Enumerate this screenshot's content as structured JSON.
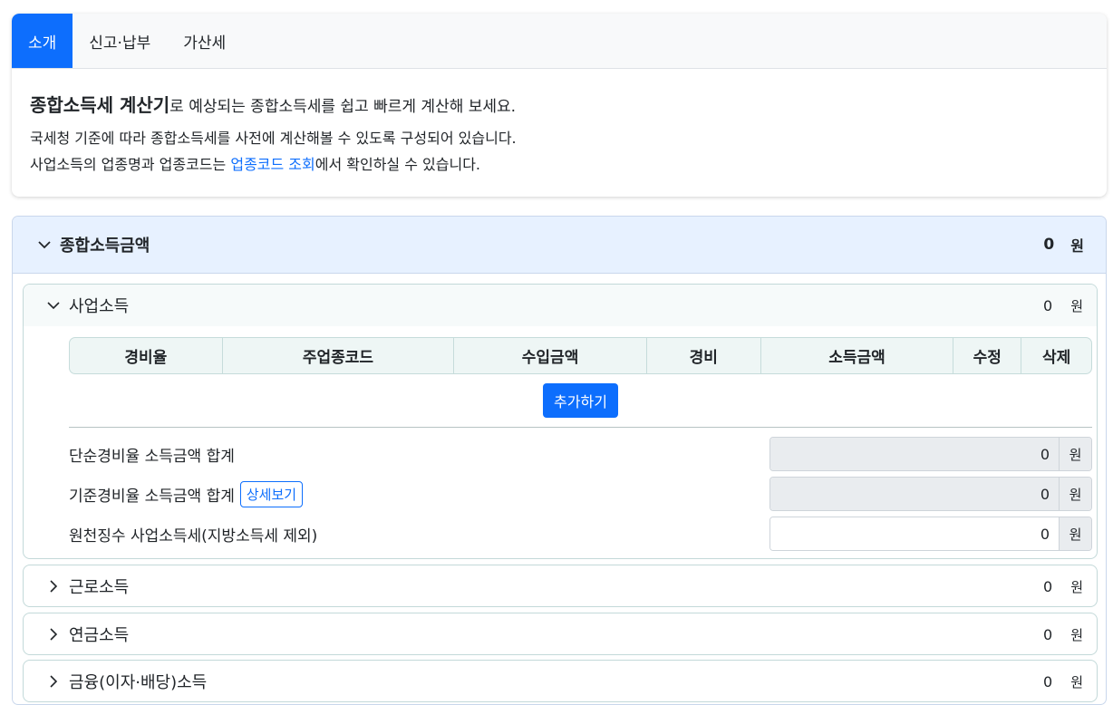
{
  "tabs": [
    {
      "label": "소개",
      "active": true
    },
    {
      "label": "신고·납부",
      "active": false
    },
    {
      "label": "가산세",
      "active": false
    }
  ],
  "intro": {
    "title_strong": "종합소득세 계산기",
    "title_rest": "로 예상되는 종합소득세를 쉽고 빠르게 계산해 보세요.",
    "line2": "국세청 기준에 따라 종합소득세를 사전에 계산해볼 수 있도록 구성되어 있습니다.",
    "line3_pre": "사업소득의 업종명과 업종코드는 ",
    "line3_link": "업종코드 조회",
    "line3_post": "에서 확인하실 수 있습니다."
  },
  "main": {
    "title": "종합소득금액",
    "amount": "0",
    "unit": "원"
  },
  "business": {
    "title": "사업소득",
    "amount": "0",
    "unit": "원",
    "columns": [
      "경비율",
      "주업종코드",
      "수입금액",
      "경비",
      "소득금액",
      "수정",
      "삭제"
    ],
    "add_label": "추가하기",
    "rows": [
      {
        "label": "단순경비율 소득금액 합계",
        "value": "0",
        "unit": "원"
      },
      {
        "label": "기준경비율 소득금액 합계",
        "button": "상세보기",
        "value": "0",
        "unit": "원"
      },
      {
        "label": "원천징수 사업소득세(지방소득세 제외)",
        "value": "0",
        "unit": "원"
      }
    ]
  },
  "sections": [
    {
      "title": "근로소득",
      "amount": "0",
      "unit": "원"
    },
    {
      "title": "연금소득",
      "amount": "0",
      "unit": "원"
    },
    {
      "title": "금융(이자·배당)소득",
      "amount": "0",
      "unit": "원"
    }
  ],
  "colors": {
    "accent": "#0d6efd",
    "header_bg": "#e7f1ff",
    "table_bg": "#eef6f5"
  }
}
